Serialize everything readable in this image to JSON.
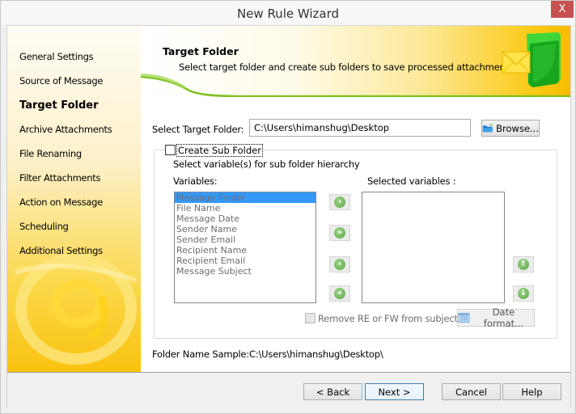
{
  "window": {
    "title": "New Rule Wizard",
    "close_label": "X"
  },
  "sidebar": {
    "items": [
      {
        "label": "General Settings",
        "active": false
      },
      {
        "label": "Source of Message",
        "active": false
      },
      {
        "label": "Target Folder",
        "active": true
      },
      {
        "label": "Archive Attachments",
        "active": false
      },
      {
        "label": "File Renaming",
        "active": false
      },
      {
        "label": "Filter Attachments",
        "active": false
      },
      {
        "label": "Action on Message",
        "active": false
      },
      {
        "label": "Scheduling",
        "active": false
      },
      {
        "label": "Additional Settings",
        "active": false
      }
    ]
  },
  "banner": {
    "title": "Target Folder",
    "subtitle": "Select target folder and create sub folders to save processed attachments."
  },
  "target": {
    "label": "Select Target Folder:",
    "value": "C:\\Users\\himanshug\\Desktop",
    "browse_label": "Browse..."
  },
  "subfolder": {
    "checkbox_label": "Create Sub Folder",
    "checked": false,
    "hint": "Select variable(s) for sub folder hierarchy",
    "variables_label": "Variables:",
    "selected_label": "Selected variables :",
    "variables": [
      "Message Folder",
      "File Name",
      "Message Date",
      "Sender Name",
      "Sender Email",
      "Recipient Name",
      "Recipient Email",
      "Message Subject"
    ],
    "selected_index": 0,
    "selected_variables": [],
    "remove_re_fw_label": "Remove RE or FW from subject",
    "remove_re_fw_checked": false,
    "date_format_label": "Date format..."
  },
  "sample": {
    "label": "Folder Name Sample:",
    "value": "C:\\Users\\himanshug\\Desktop\\"
  },
  "footer": {
    "back_label": "< Back",
    "next_label": "Next >",
    "cancel_label": "Cancel",
    "help_label": "Help"
  },
  "icons": {
    "add": "chevron-right",
    "add_all": "double-chevron-right",
    "remove": "chevron-left",
    "remove_all": "double-chevron-left",
    "move_up": "arrow-up",
    "move_down": "arrow-down"
  },
  "colors": {
    "accent_green": "#5aab43",
    "close_red": "#c75050",
    "selection_blue": "#3399ff",
    "banner_yellow": "#f8bd00"
  }
}
